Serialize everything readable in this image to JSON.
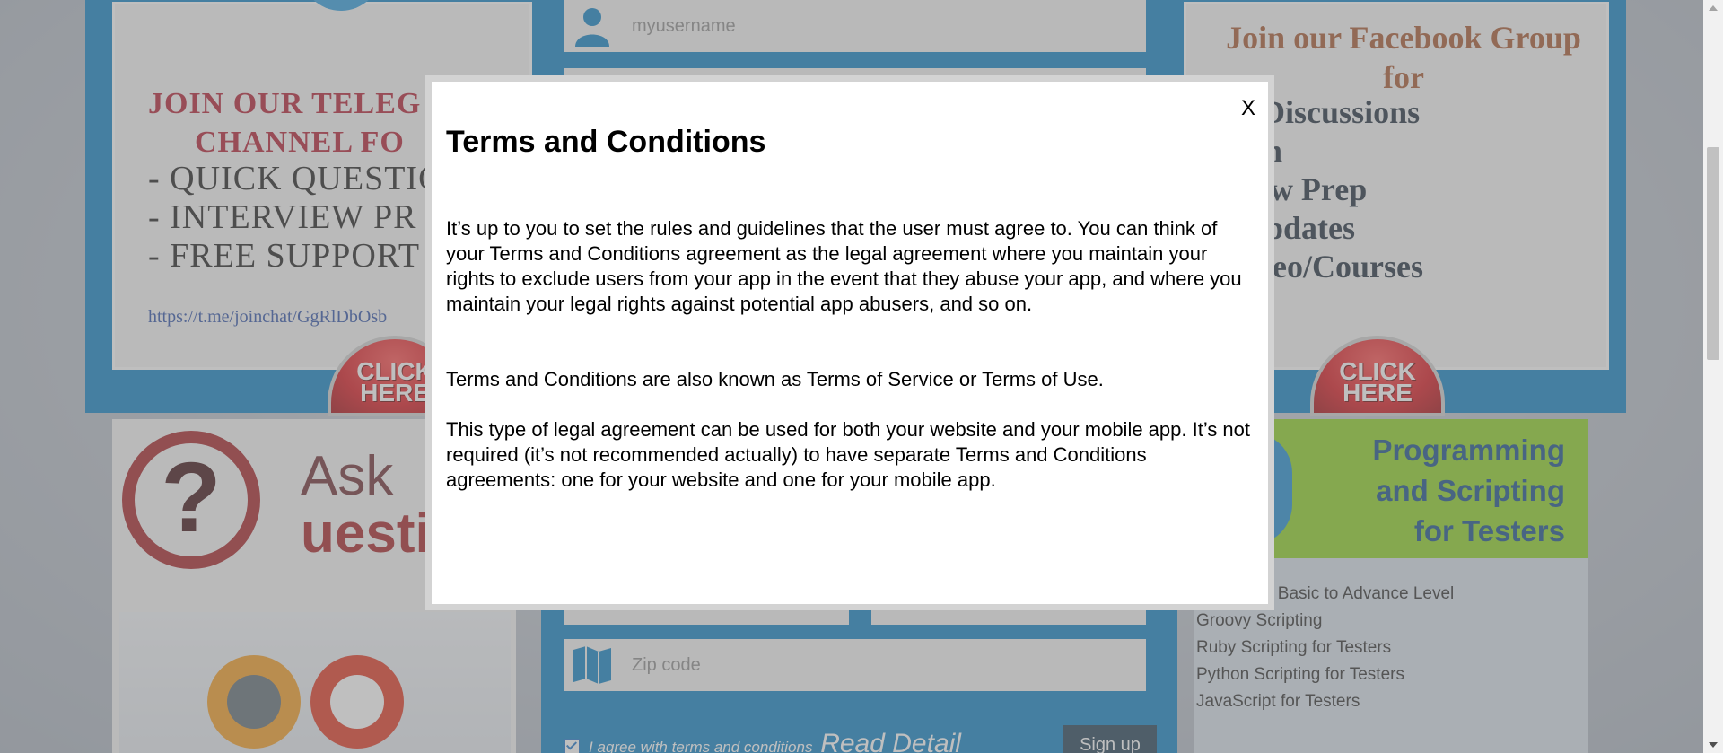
{
  "telegram_promo": {
    "title_line1": "JOIN OUR TELEG",
    "title_line2": "CHANNEL  FO",
    "items": [
      "- QUICK QUESTIC",
      "- INTERVIEW PR",
      "- FREE SUPPORT"
    ],
    "link": "https://t.me/joinchat/GgRlDbOsb",
    "click_line1": "CLICK",
    "click_line2": "HERE"
  },
  "facebook_promo": {
    "title_line1": "Join our Facebook Group",
    "title_line2": "for",
    "items": [
      "oup Discussions",
      "estion",
      "erview Prep",
      "ck Updates",
      "e Video/Courses"
    ],
    "click_line1": "CLICK",
    "click_line2": "HERE"
  },
  "signup_form": {
    "username_placeholder": "myusername",
    "zip_placeholder": "Zip code",
    "agree_label": "I agree with terms and conditions",
    "read_detail": "Read Detail",
    "signup_label": "Sign up"
  },
  "ask_card": {
    "text_line1": "Ask",
    "text_line2": "uesti"
  },
  "programming_card": {
    "title_line1": "Programming",
    "title_line2": "and Scripting",
    "title_line3": "for Testers",
    "items": [
      "ramming - Basic to Advance Level",
      "Groovy Scripting",
      "Ruby Scripting for Testers",
      "Python Scripting for Testers",
      "JavaScript for Testers"
    ]
  },
  "modal": {
    "close_label": "X",
    "title": "Terms and Conditions",
    "paragraph1": "It’s up to you to set the rules and guidelines that the user must agree to. You can think of your Terms and Conditions agreement as the legal agreement where you maintain your rights to exclude users from your app in the event that they abuse your app, and where you maintain your legal rights against potential app abusers, and so on.",
    "paragraph2": "Terms and Conditions are also known as Terms of Service or Terms of Use.",
    "paragraph3": "This type of legal agreement can be used for both your website and your mobile app. It’s not required (it’s not recommended actually) to have separate Terms and Conditions agreements: one for your website and one for your mobile app."
  },
  "colors": {
    "panel_blue": "#0a7ec2",
    "telegram_red": "#b11a2f",
    "facebook_brown": "#a4542d",
    "programming_green": "#8ad11e",
    "programming_navy": "#114a87"
  }
}
